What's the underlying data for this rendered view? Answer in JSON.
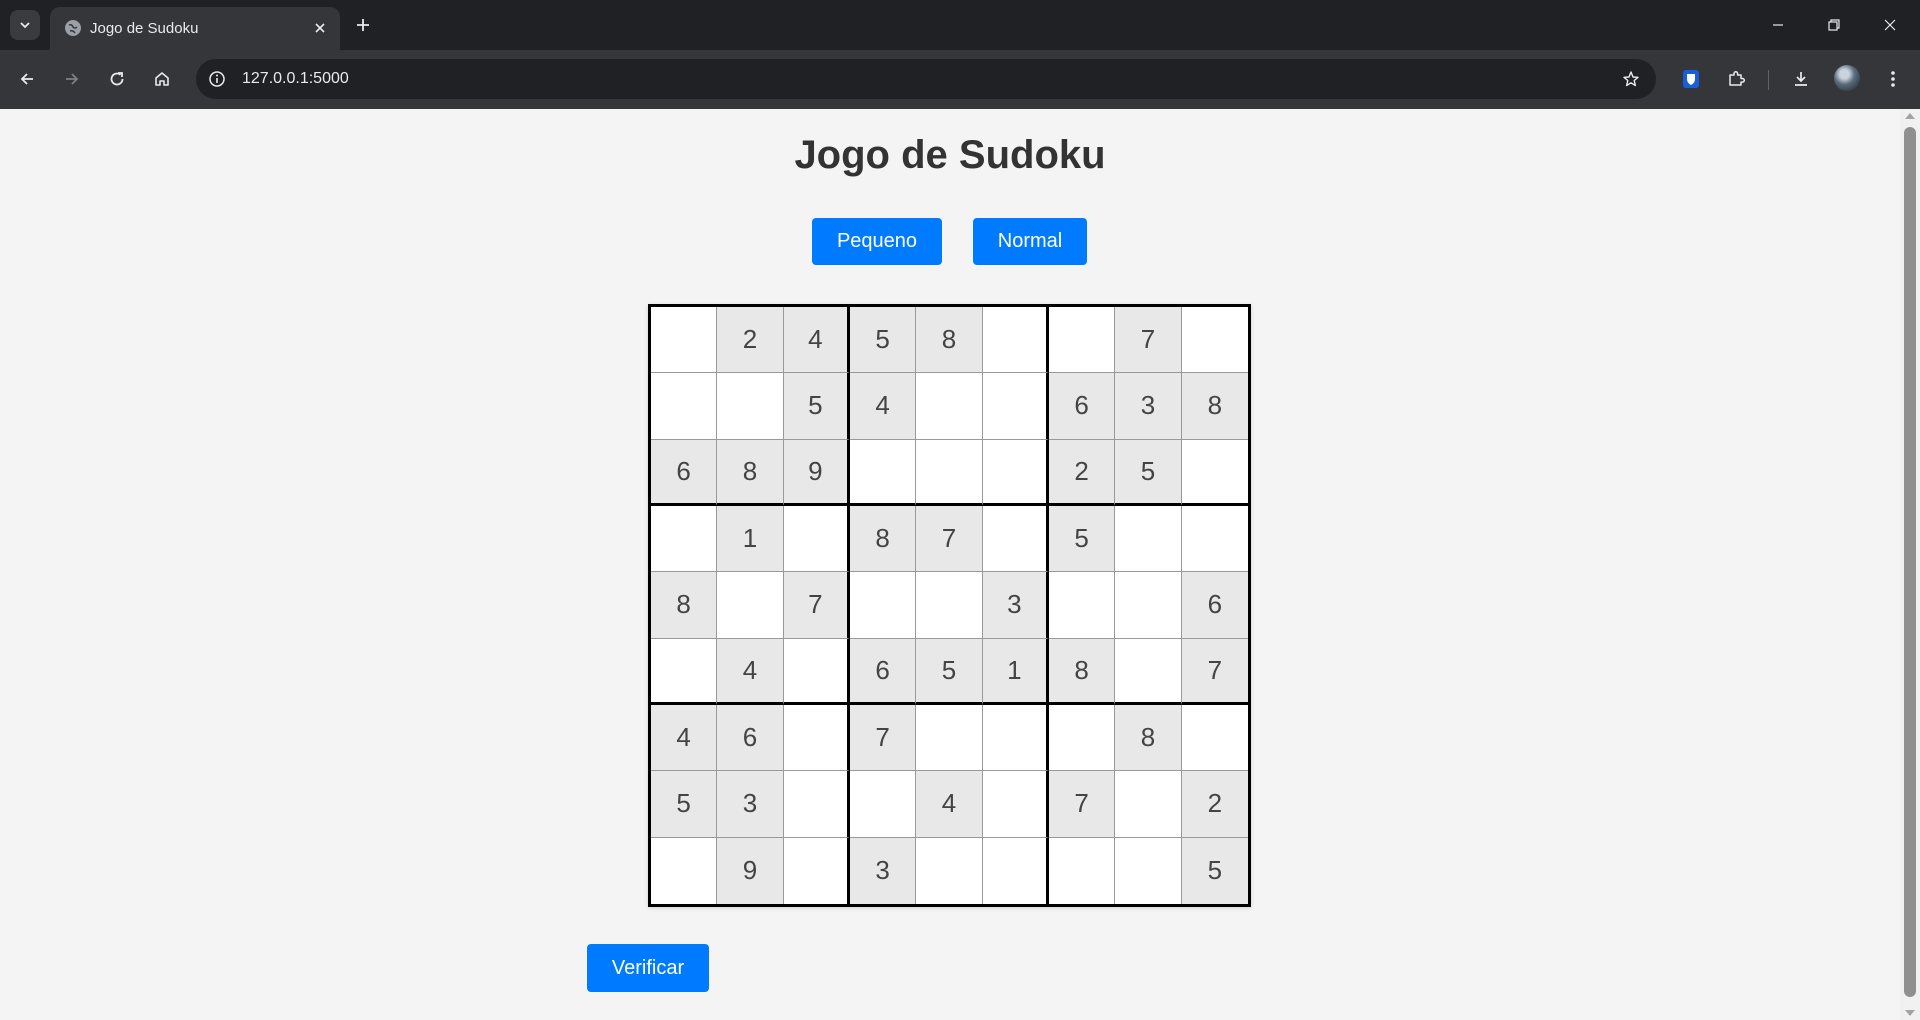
{
  "browser": {
    "tab_title": "Jogo de Sudoku",
    "url": "127.0.0.1:5000"
  },
  "page": {
    "title": "Jogo de Sudoku",
    "buttons": {
      "small": "Pequeno",
      "normal": "Normal",
      "check": "Verificar"
    }
  },
  "sudoku": {
    "size": 9,
    "grid": [
      [
        "",
        "2",
        "4",
        "5",
        "8",
        "",
        "",
        "7",
        ""
      ],
      [
        "",
        "",
        "5",
        "4",
        "",
        "",
        "6",
        "3",
        "8"
      ],
      [
        "6",
        "8",
        "9",
        "",
        "",
        "",
        "2",
        "5",
        ""
      ],
      [
        "",
        "1",
        "",
        "8",
        "7",
        "",
        "5",
        "",
        ""
      ],
      [
        "8",
        "",
        "7",
        "",
        "",
        "3",
        "",
        "",
        "6"
      ],
      [
        "",
        "4",
        "",
        "6",
        "5",
        "1",
        "8",
        "",
        "7"
      ],
      [
        "4",
        "6",
        "",
        "7",
        "",
        "",
        "",
        "8",
        ""
      ],
      [
        "5",
        "3",
        "",
        "",
        "4",
        "",
        "7",
        "",
        "2"
      ],
      [
        "",
        "9",
        "",
        "3",
        "",
        "",
        "",
        "",
        "5"
      ]
    ]
  },
  "colors": {
    "primary_button": "#007bff",
    "given_cell": "#e8e8e8",
    "empty_cell": "#ffffff",
    "page_background": "#f4f4f4"
  }
}
